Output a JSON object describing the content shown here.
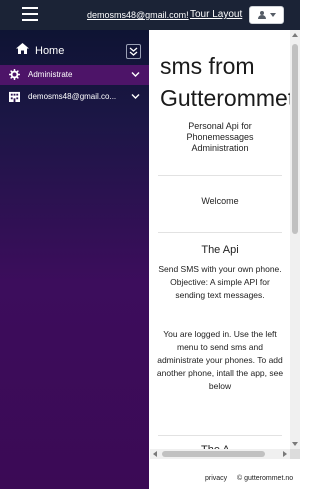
{
  "topbar": {
    "email": "demosms48@gmail.com!",
    "tour_label": "Tour Layout"
  },
  "sidebar": {
    "home_label": "Home",
    "items": [
      {
        "label": "Administrate",
        "icon": "gear-icon",
        "active": true
      },
      {
        "label": "demosms48@gmail.co...",
        "icon": "building-icon",
        "active": false
      }
    ]
  },
  "main": {
    "title_line1": "sms from",
    "title_line2": "Gutterommet",
    "subtitle_line1": "Personal Api for",
    "subtitle_line2": "Phonemessages",
    "subtitle_line3": "Administration",
    "welcome": "Welcome",
    "api_heading": "The Api",
    "api_para1": "Send SMS with your own phone. Objective: A simple API for sending text messages.",
    "api_para2": "You are logged in. Use the left menu to send sms and administrate your phones. To add another phone, intall the app, see below",
    "next_heading": "The A..."
  },
  "footer": {
    "privacy": "privacy",
    "copyright": "© gutterommet.no"
  },
  "colors": {
    "topbar": "#1b2336",
    "sidebar_top": "#0e1433",
    "sidebar_bottom": "#3b0a55",
    "active_item": "#4d1468"
  }
}
